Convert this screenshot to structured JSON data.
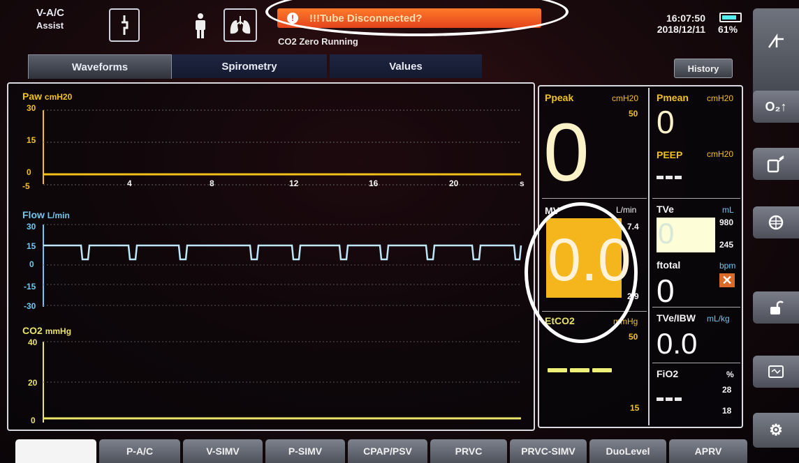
{
  "header": {
    "mode_line1": "V-A/C",
    "mode_line2": "Assist",
    "alarm_text": "!!!Tube Disconnected?",
    "status_text": "CO2 Zero Running",
    "time": "16:07:50",
    "date": "2018/12/11",
    "battery": "61%",
    "alarm_color": "#f0601f"
  },
  "tabs": [
    {
      "label": "Waveforms",
      "active": true
    },
    {
      "label": "Spirometry",
      "active": false
    },
    {
      "label": "Values",
      "active": false
    }
  ],
  "history_label": "History",
  "waveforms": {
    "paw": {
      "name": "Paw",
      "unit": "cmH20",
      "ticks": [
        "30",
        "15",
        "0",
        "-5"
      ],
      "xticks": [
        "4",
        "8",
        "12",
        "16",
        "20",
        "s"
      ]
    },
    "flow": {
      "name": "Flow",
      "unit": "L/min",
      "ticks": [
        "30",
        "15",
        "0",
        "-15",
        "-30"
      ]
    },
    "co2": {
      "name": "CO2",
      "unit": "mmHg",
      "ticks": [
        "40",
        "20",
        "0"
      ]
    }
  },
  "values": {
    "ppeak": {
      "label": "Ppeak",
      "unit": "cmH20",
      "limit": "50",
      "value": "0"
    },
    "pmean": {
      "label": "Pmean",
      "unit": "cmH20",
      "value": "0"
    },
    "peep": {
      "label": "PEEP",
      "unit": "cmH20",
      "value": "---"
    },
    "mv": {
      "label": "MV",
      "unit": "L/min",
      "limit_high": "7.4",
      "limit_low": "2.9",
      "value": "0.0"
    },
    "tve": {
      "label": "TVe",
      "unit": "mL",
      "limit_high": "980",
      "limit_low": "245",
      "value": "0"
    },
    "ftotal": {
      "label": "ftotal",
      "unit": "bpm",
      "value": "0"
    },
    "etco2": {
      "label": "EtCO2",
      "unit": "mmHg",
      "limit_high": "50",
      "limit_low": "15",
      "value": "---"
    },
    "tveibw": {
      "label": "TVe/IBW",
      "unit": "mL/kg",
      "value": "0.0"
    },
    "fio2": {
      "label": "FiO2",
      "unit": "%",
      "limit_high": "28",
      "limit_low": "18",
      "value": "---"
    }
  },
  "side_buttons": [
    "freeze-icon",
    "o2-boost-icon",
    "suction-icon",
    "nebulizer-icon",
    "unlock-icon",
    "screen-icon",
    "settings-icon"
  ],
  "side_labels": {
    "o2": "O₂↑"
  },
  "mode_tabs": [
    "",
    "P-A/C",
    "V-SIMV",
    "P-SIMV",
    "CPAP/PSV",
    "PRVC",
    "PRVC-SIMV",
    "DuoLevel",
    "APRV"
  ]
}
